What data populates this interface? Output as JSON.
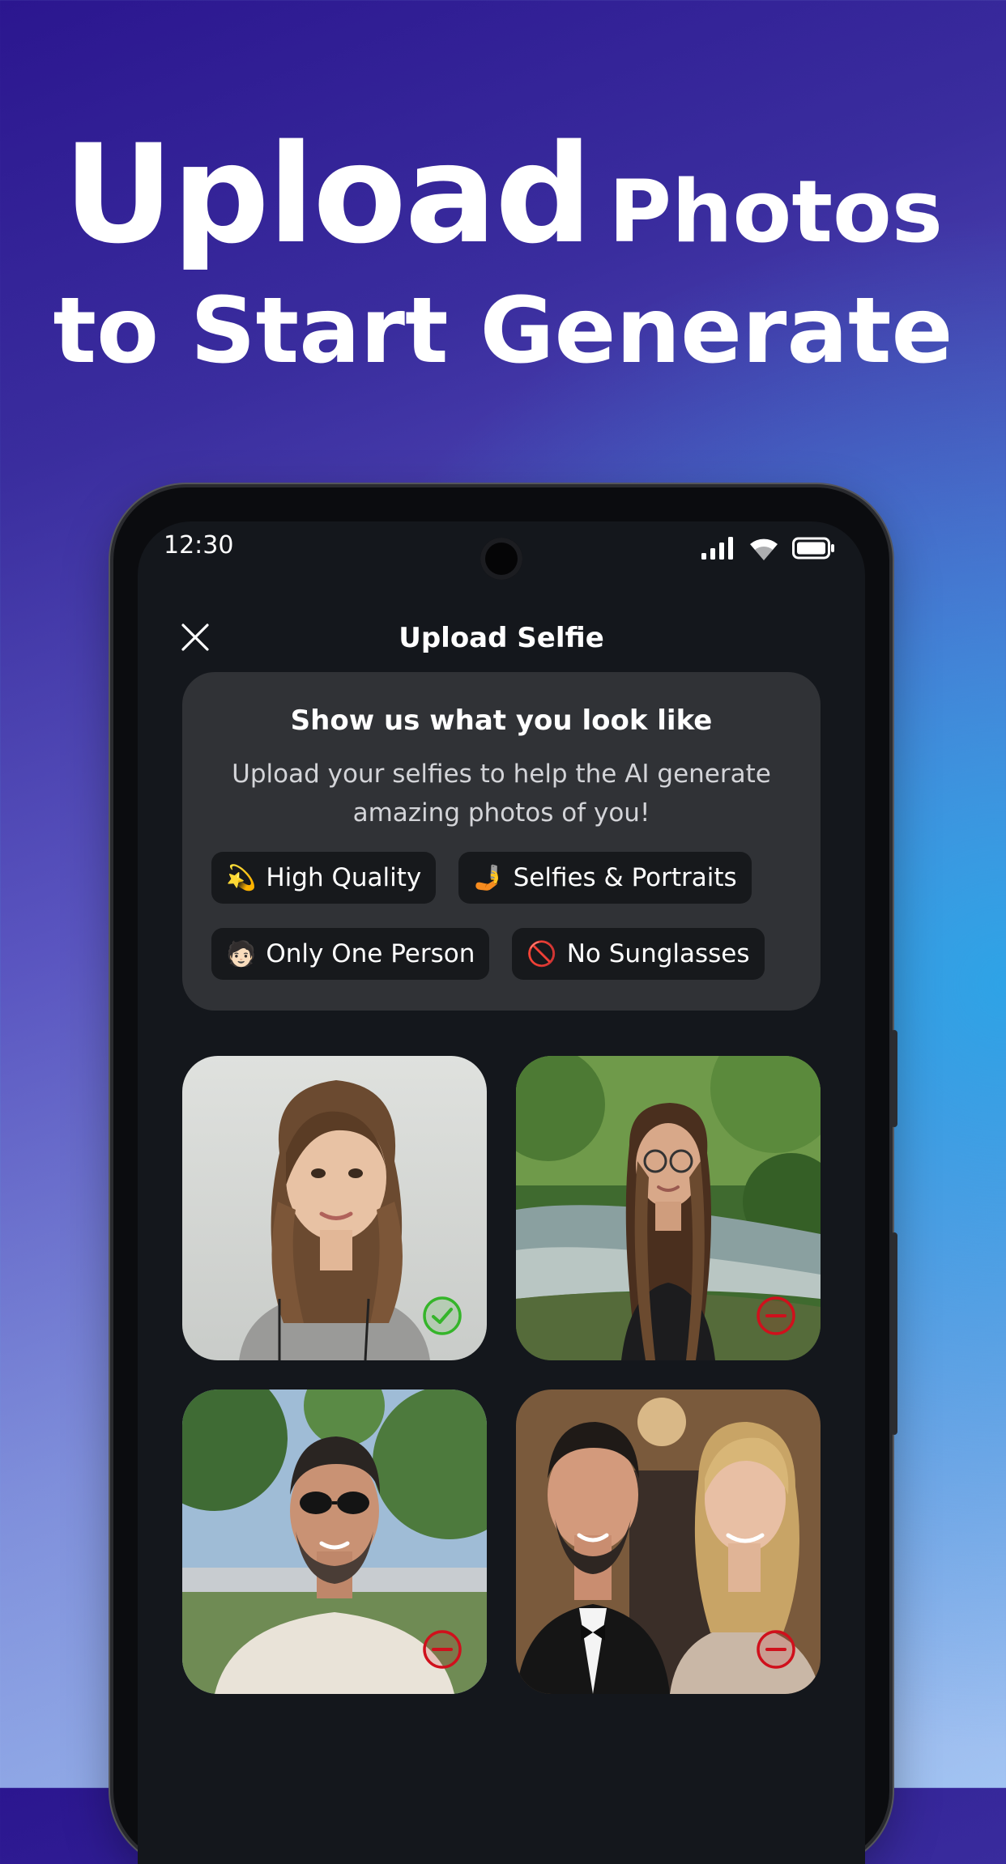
{
  "headline": {
    "line1_big": "Upload",
    "line1_small": "Photos",
    "line2": "to Start Generate"
  },
  "status_bar": {
    "time": "12:30",
    "icons": [
      "signal-icon",
      "wifi-icon",
      "battery-icon"
    ]
  },
  "nav": {
    "title": "Upload Selfie",
    "close_icon": "close-icon"
  },
  "info": {
    "title": "Show us what you look like",
    "subtitle": "Upload your selfies to help the AI generate amazing photos of you!",
    "chips": [
      {
        "emoji": "💫",
        "label": "High Quality"
      },
      {
        "emoji": "🤳",
        "label": "Selfies & Portraits"
      },
      {
        "emoji": "🧑🏻",
        "label": "Only One Person"
      },
      {
        "emoji": "🚫",
        "label": "No Sunglasses"
      }
    ]
  },
  "photos": [
    {
      "subject": "woman portrait, light background",
      "status": "accepted",
      "status_icon": "check-circle-icon"
    },
    {
      "subject": "woman with glasses by a forest stream",
      "status": "rejected",
      "status_icon": "minus-circle-icon"
    },
    {
      "subject": "man wearing sunglasses outdoors",
      "status": "rejected",
      "status_icon": "minus-circle-icon"
    },
    {
      "subject": "couple at a formal event",
      "status": "rejected",
      "status_icon": "minus-circle-icon"
    }
  ],
  "colors": {
    "accepted": "#35b52a",
    "rejected": "#d0101c",
    "card_bg": "#303236",
    "chip_bg": "#17191c",
    "screen_bg": "#14171c"
  }
}
